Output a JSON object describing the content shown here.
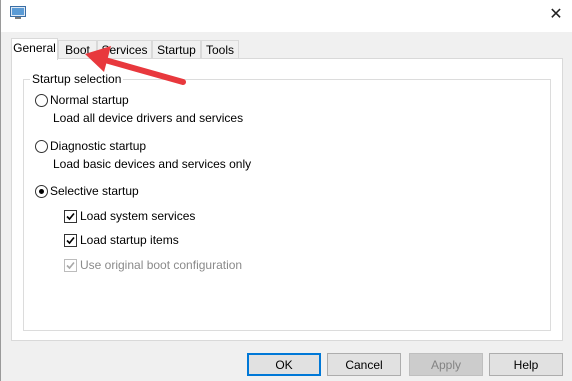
{
  "window": {
    "close_glyph": "✕",
    "icon": "msconfig-icon"
  },
  "tabs": [
    {
      "label": "General",
      "active": true
    },
    {
      "label": "Boot",
      "active": false
    },
    {
      "label": "Services",
      "active": false
    },
    {
      "label": "Startup",
      "active": false
    },
    {
      "label": "Tools",
      "active": false
    }
  ],
  "startup_selection": {
    "legend": "Startup selection",
    "normal": {
      "label": "Normal startup",
      "desc": "Load all device drivers and services",
      "selected": false
    },
    "diagnostic": {
      "label": "Diagnostic startup",
      "desc": "Load basic devices and services only",
      "selected": false
    },
    "selective": {
      "label": "Selective startup",
      "selected": true,
      "options": [
        {
          "label": "Load system services",
          "checked": true,
          "enabled": true
        },
        {
          "label": "Load startup items",
          "checked": true,
          "enabled": true
        },
        {
          "label": "Use original boot configuration",
          "checked": true,
          "enabled": false
        }
      ]
    }
  },
  "buttons": {
    "ok": "OK",
    "cancel": "Cancel",
    "apply": "Apply",
    "help": "Help"
  },
  "annotation": {
    "arrow_color": "#e8383d",
    "points_to": "Boot tab"
  },
  "colors": {
    "focus_border": "#0078d7"
  }
}
